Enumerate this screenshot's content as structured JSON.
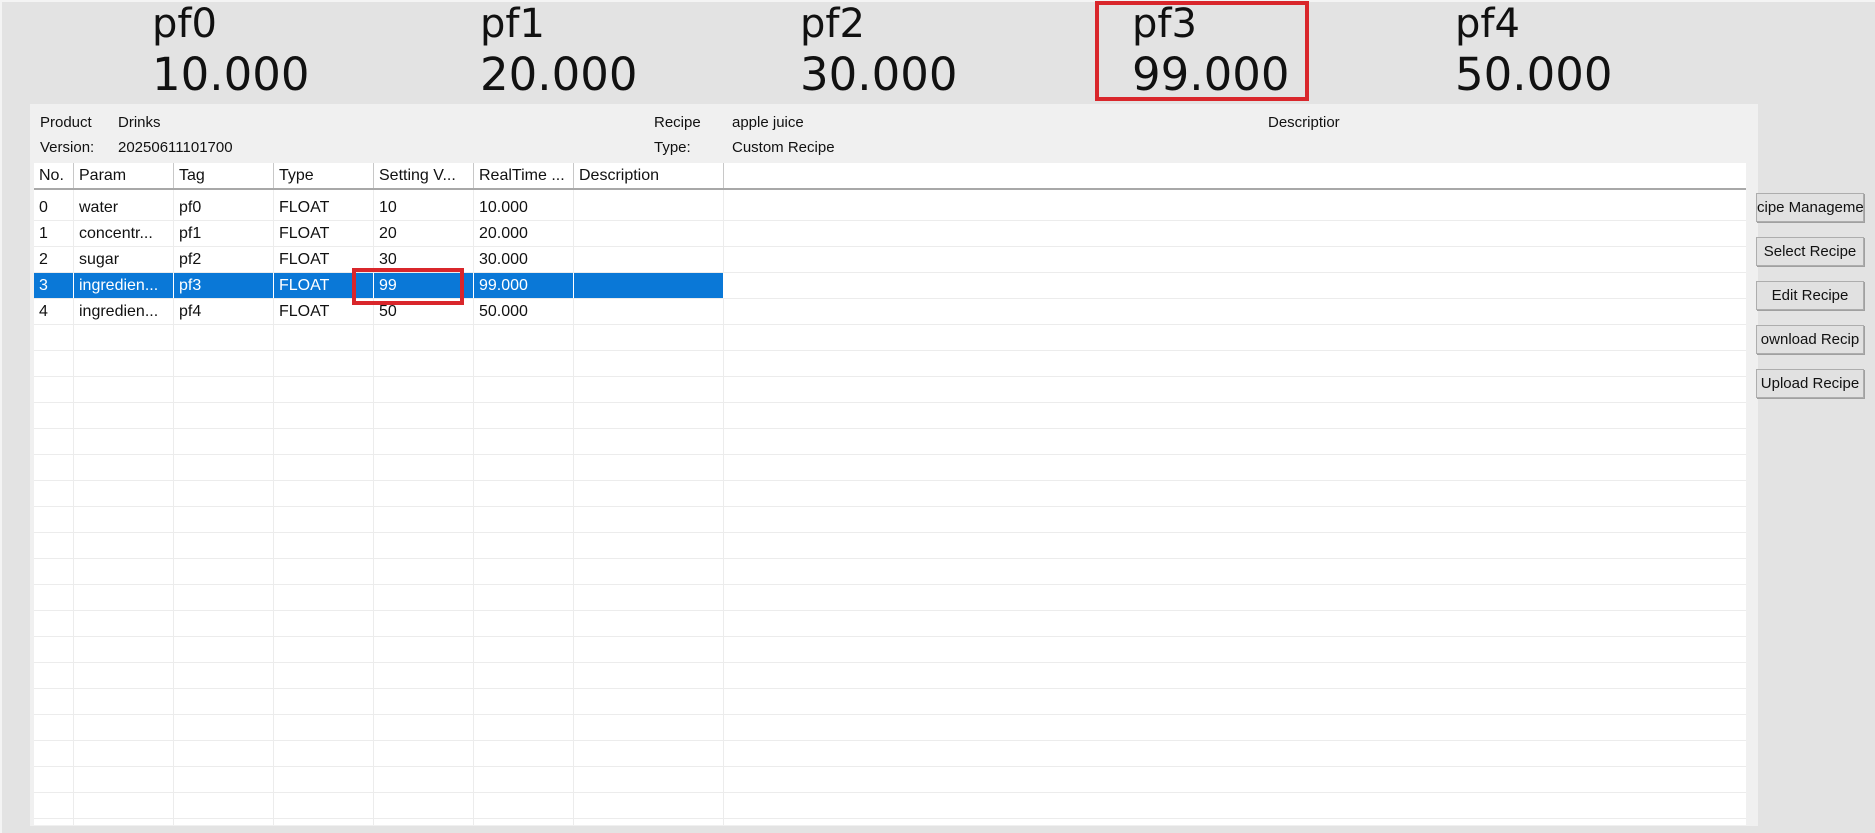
{
  "header_params": [
    {
      "name": "pf0",
      "value": "10.000"
    },
    {
      "name": "pf1",
      "value": "20.000"
    },
    {
      "name": "pf2",
      "value": "30.000"
    },
    {
      "name": "pf3",
      "value": "99.000"
    },
    {
      "name": "pf4",
      "value": "50.000"
    }
  ],
  "recipe_info": {
    "product_label": "Product",
    "product_value": "Drinks",
    "version_label": "Version:",
    "version_value": "20250611101700",
    "recipe_label": "Recipe",
    "recipe_value": "apple juice",
    "type_label": "Type:",
    "type_value": "Custom Recipe",
    "description_label": "Descriptior"
  },
  "table": {
    "columns": [
      "No.",
      "Param",
      "Tag",
      "Type",
      "Setting V...",
      "RealTime ...",
      "Description"
    ],
    "rows": [
      [
        "0",
        "water",
        "pf0",
        "FLOAT",
        "10",
        "10.000",
        ""
      ],
      [
        "1",
        "concentr...",
        "pf1",
        "FLOAT",
        "20",
        "20.000",
        ""
      ],
      [
        "2",
        "sugar",
        "pf2",
        "FLOAT",
        "30",
        "30.000",
        ""
      ],
      [
        "3",
        "ingredien...",
        "pf3",
        "FLOAT",
        "99",
        "99.000",
        ""
      ],
      [
        "4",
        "ingredien...",
        "pf4",
        "FLOAT",
        "50",
        "50.000",
        ""
      ]
    ]
  },
  "buttons": {
    "recipe_management": "cipe Manageme",
    "select_recipe": "Select Recipe",
    "edit_recipe": "Edit Recipe",
    "download_recipe": "ownload Recip",
    "upload_recipe": "Upload Recipe"
  },
  "colors": {
    "selection": "#0a78d7",
    "highlight_border": "#d9262b"
  }
}
